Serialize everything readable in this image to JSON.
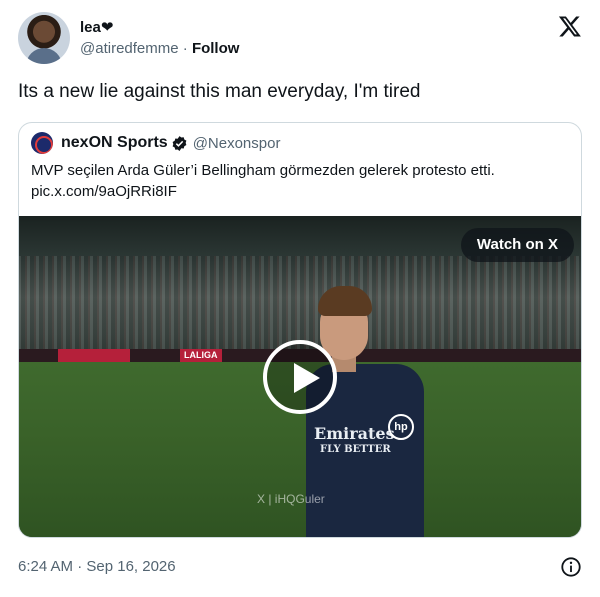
{
  "author": {
    "display_name": "lea❤",
    "handle": "@atiredfemme",
    "separator": "·",
    "follow_label": "Follow"
  },
  "tweet": {
    "text": "Its a new lie against this man everyday, I'm tired",
    "timestamp": "6:24 AM · Sep 16, 2026"
  },
  "quoted": {
    "display_name": "nexON Sports",
    "handle": "@Nexonspor",
    "text": "MVP seçilen Arda Güler’i Bellingham görmezden gelerek protesto etti.",
    "link": "pic.x.com/9aOjRRi8IF",
    "media": {
      "watch_label": "Watch on X",
      "watermark": "X | iHQGuler",
      "boards": [
        "LALIGA"
      ],
      "jersey_sponsor_line1": "Emirates",
      "jersey_sponsor_line2": "FLY BETTER",
      "jersey_logo": "hp"
    }
  },
  "colors": {
    "text_primary": "#0f1419",
    "text_secondary": "#536471",
    "border": "#cfd9de",
    "verified": "#1d9bf0"
  },
  "icons": [
    "x-logo-icon",
    "verified-badge-icon",
    "play-icon",
    "info-icon"
  ]
}
